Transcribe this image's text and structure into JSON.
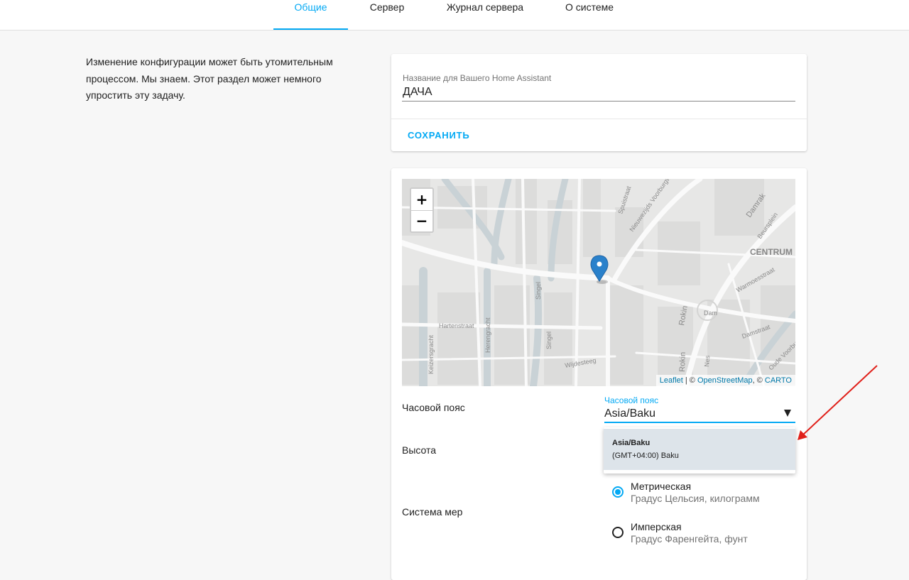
{
  "tabs": [
    {
      "label": "Общие",
      "active": true
    },
    {
      "label": "Сервер",
      "active": false
    },
    {
      "label": "Журнал сервера",
      "active": false
    },
    {
      "label": "О системе",
      "active": false
    }
  ],
  "intro": "Изменение конфигурации может быть утомительным процессом. Мы знаем. Этот раздел может немного упростить эту задачу.",
  "name_card": {
    "label": "Название для Вашего Home Assistant",
    "value": "ДАЧА",
    "save_label": "СОХРАНИТЬ"
  },
  "map": {
    "zoom_in": "+",
    "zoom_out": "−",
    "attribution": {
      "leaflet": "Leaflet",
      "sep1": " | © ",
      "osm": "OpenStreetMap",
      "sep2": ", © ",
      "carto": "CARTO"
    },
    "labels": [
      "Spuistraat",
      "Nieuwezijds Voorburgwal",
      "Damrak",
      "Beursplein",
      "CENTRUM",
      "Warmoesstraat",
      "Keizersgracht",
      "Herengracht",
      "Singel",
      "Hartenstraat",
      "Rokin",
      "Dam",
      "Damstraat",
      "Oude Voorburgwal",
      "Wijdesteeg",
      "Nes"
    ]
  },
  "timezone": {
    "row_label": "Часовой пояс",
    "field_label": "Часовой пояс",
    "value": "Asia/Baku",
    "option_title": "Asia/Baku",
    "option_sub": "(GMT+04:00) Baku"
  },
  "elevation": {
    "row_label": "Высота"
  },
  "unit_system": {
    "row_label": "Система мер",
    "metric": {
      "title": "Метрическая",
      "sub": "Градус Цельсия, килограмм",
      "checked": true
    },
    "imperial": {
      "title": "Имперская",
      "sub": "Градус Фаренгейта, фунт",
      "checked": false
    }
  },
  "colors": {
    "accent": "#03a9f4",
    "marker": "#2a81cb",
    "annotation": "#e0201a"
  }
}
